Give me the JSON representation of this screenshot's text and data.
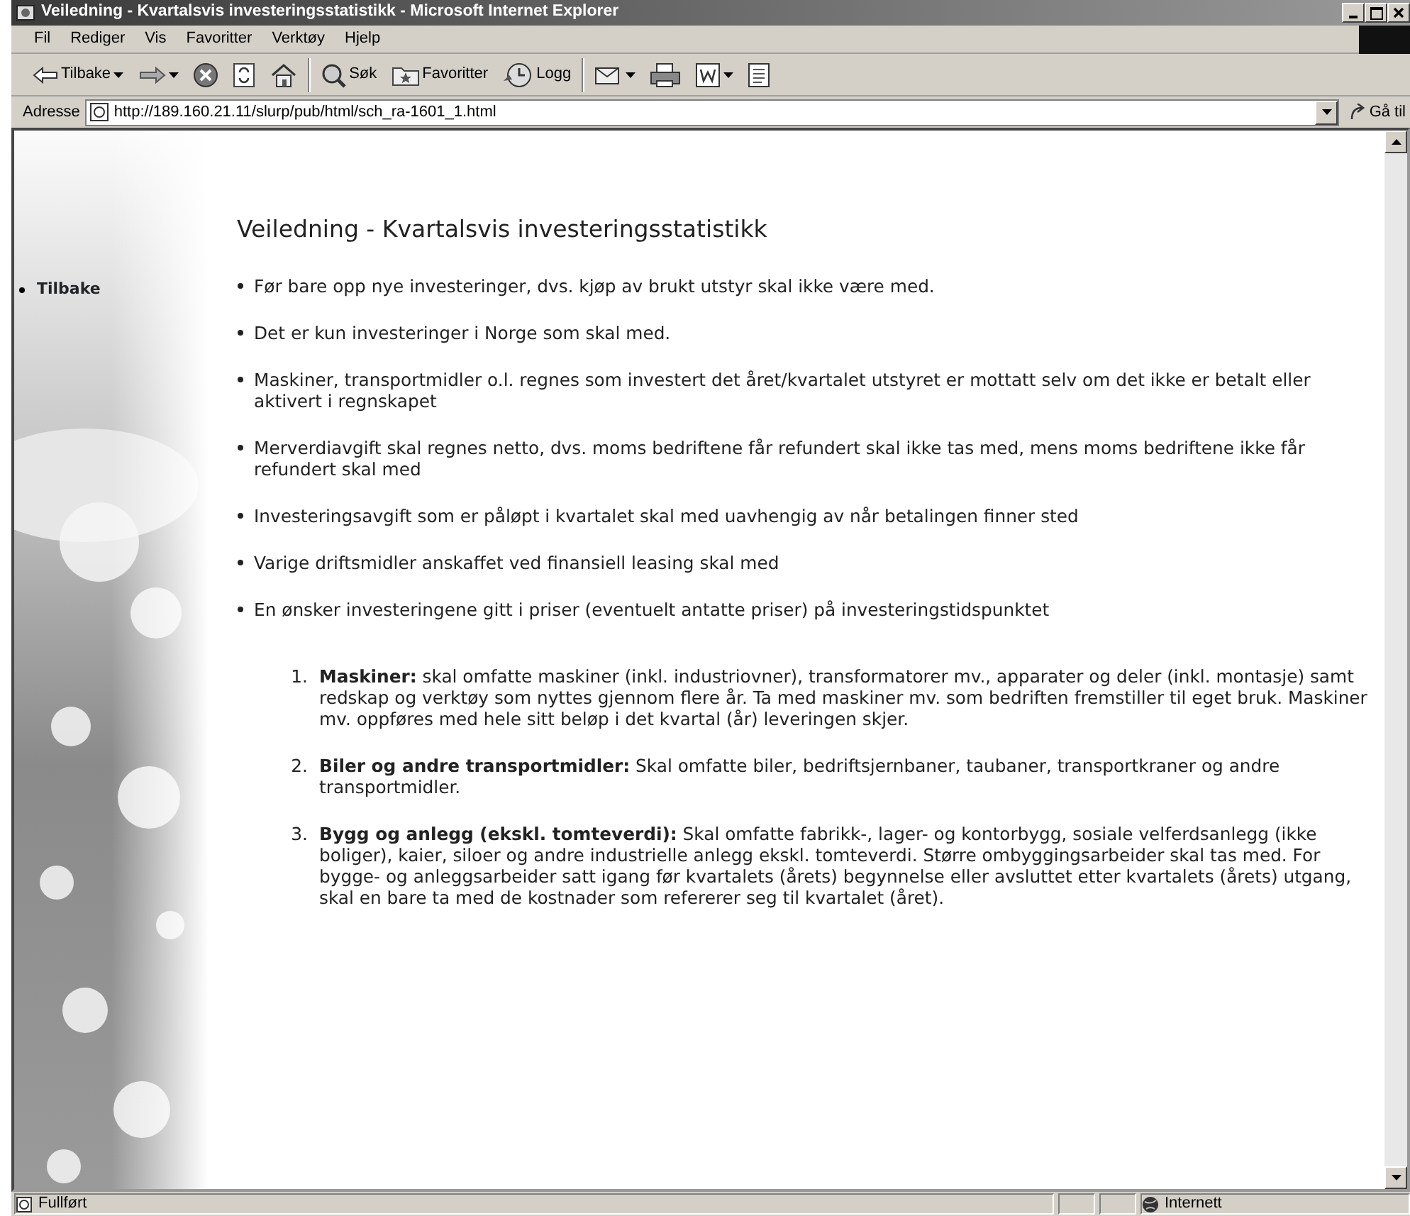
{
  "window": {
    "title": "Veiledning - Kvartalsvis investeringsstatistikk - Microsoft Internet Explorer"
  },
  "menu": [
    "Fil",
    "Rediger",
    "Vis",
    "Favoritter",
    "Verktøy",
    "Hjelp"
  ],
  "toolbar": [
    {
      "kind": "back",
      "label": "Tilbake",
      "dropdown": true
    },
    {
      "kind": "forward",
      "dropdown": true
    },
    {
      "kind": "stop"
    },
    {
      "kind": "refresh"
    },
    {
      "kind": "home"
    },
    {
      "kind": "separator"
    },
    {
      "kind": "search",
      "label": "Søk"
    },
    {
      "kind": "favorites",
      "label": "Favoritter"
    },
    {
      "kind": "history",
      "label": "Logg"
    },
    {
      "kind": "separator"
    },
    {
      "kind": "mail",
      "dropdown": true
    },
    {
      "kind": "print"
    },
    {
      "kind": "word",
      "dropdown": true
    },
    {
      "kind": "discuss"
    }
  ],
  "address": {
    "label": "Adresse",
    "url": "http://189.160.21.11/slurp/pub/html/sch_ra-1601_1.html",
    "go": "Gå til"
  },
  "sidebar": {
    "links": [
      "Tilbake"
    ]
  },
  "page": {
    "heading": "Veiledning - Kvartalsvis investeringsstatistikk",
    "bullets": [
      "Før bare opp nye investeringer, dvs. kjøp av brukt utstyr skal ikke være med.",
      "Det er kun investeringer i Norge som skal med.",
      "Maskiner, transportmidler o.l. regnes som investert det året/kvartalet utstyret er mottatt selv om det ikke er betalt eller aktivert i regnskapet",
      "Merverdiavgift skal regnes netto, dvs. moms bedriftene får refundert skal ikke tas med, mens moms bedriftene ikke får refundert skal med",
      "Investeringsavgift som er påløpt i kvartalet skal med uavhengig av når betalingen finner sted",
      "Varige driftsmidler anskaffet ved finansiell leasing skal med",
      "En ønsker investeringene gitt i priser (eventuelt antatte priser) på investeringstidspunktet"
    ],
    "numbered": [
      {
        "number": "1.",
        "text": "**Maskiner:** skal omfatte maskiner (inkl. industriovner), transformatorer mv., apparater og deler (inkl. montasje) samt redskap og verktøy som nyttes gjennom flere år. Ta med maskiner mv. som bedriften fremstiller til eget bruk. Maskiner mv. oppføres med hele sitt beløp i det kvartal (år) leveringen skjer."
      },
      {
        "number": "2.",
        "text": "**Biler og andre transportmidler:** Skal omfatte biler, bedriftsjernbaner, taubaner, transportkraner og andre transportmidler."
      },
      {
        "number": "3.",
        "text": "**Bygg og anlegg (ekskl. tomteverdi):** Skal omfatte fabrikk-, lager- og kontorbygg, sosiale velferdsanlegg (ikke boliger), kaier, siloer og andre industrielle anlegg ekskl. tomteverdi. Større ombyggingsarbeider skal tas med. For bygge- og anleggsarbeider satt igang før kvartalets (årets) begynnelse eller avsluttet etter kvartalets (årets) utgang, skal en bare ta med de kostnader som refererer seg til kvartalet (året)."
      }
    ]
  },
  "status_bar": {
    "text": "Fullført",
    "zone": "Internett"
  }
}
